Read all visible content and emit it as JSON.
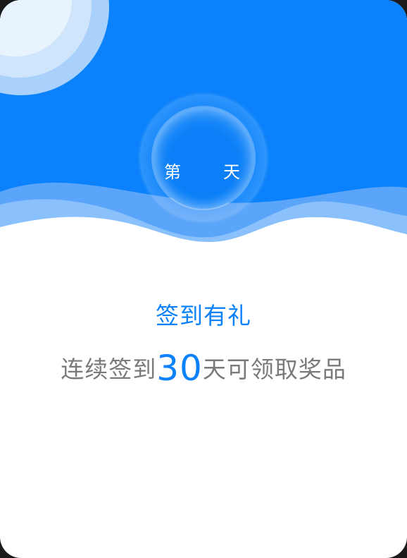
{
  "badge": {
    "prefix": "第",
    "suffix": "天"
  },
  "content": {
    "title": "签到有礼",
    "subtitle_before": "连续签到",
    "subtitle_number": "30",
    "subtitle_after": "天可领取奖品"
  },
  "colors": {
    "primary": "#0b82fb",
    "wave_light": "#7bb8fb",
    "text_gray": "#7a7a7a",
    "background": "#ffffff"
  }
}
